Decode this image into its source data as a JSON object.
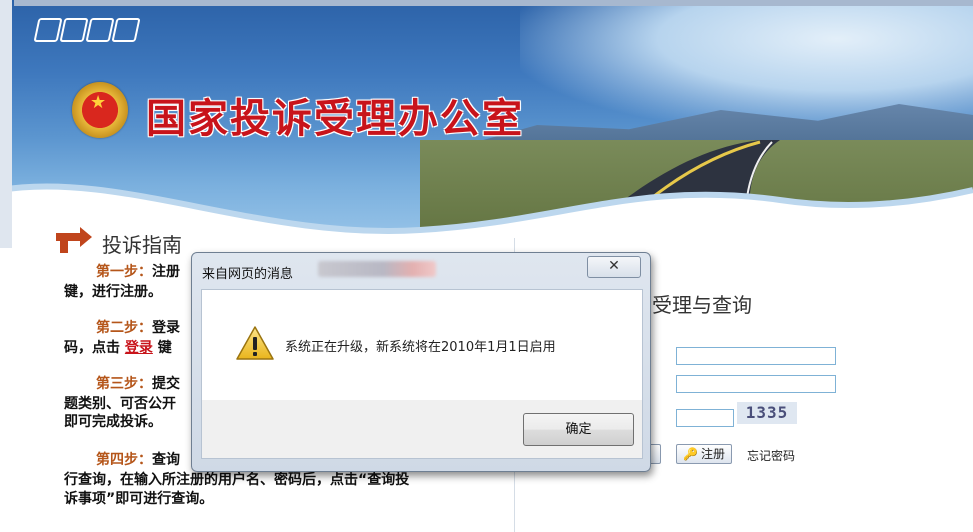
{
  "header": {
    "site_title": "国家投诉受理办公室"
  },
  "guide": {
    "title": "投诉指南",
    "steps": [
      {
        "label": "第一步：",
        "line1": "注册",
        "line2": "键，进行注册。"
      },
      {
        "label": "第二步：",
        "line1": "登录",
        "line2_pre": "码，点击",
        "link": "登录",
        "line2_post": "键"
      },
      {
        "label": "第三步：",
        "line1": "提交",
        "line2": "题类别、可否公开",
        "line3": "即可完成投诉。"
      },
      {
        "label": "第四步：",
        "line1": "查询",
        "line2": "行查询，在输入所注册的用户名、密码后，点击“查询投",
        "line3": "诉事项”即可进行查询。"
      }
    ]
  },
  "query": {
    "title": "诉受理与查询",
    "captcha": "1335",
    "register_label": "注册",
    "forgot_label": "忘记密码"
  },
  "dialog": {
    "title": "来自网页的消息",
    "close_glyph": "✕",
    "message": "系统正在升级，新系统将在2010年1月1日启用",
    "ok_label": "确定"
  },
  "colors": {
    "title_red": "#c8141b",
    "step_label": "#b5561a",
    "input_border": "#7fb2d6"
  }
}
